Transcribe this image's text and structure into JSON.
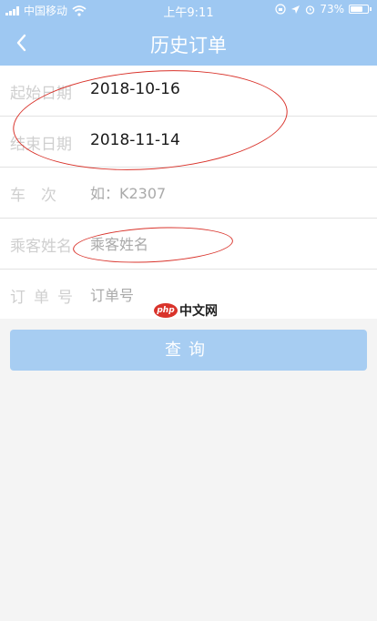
{
  "status_bar": {
    "carrier": "中国移动",
    "time": "上午9:11",
    "battery_text": "73%",
    "battery_level": 0.73,
    "icons": [
      "signal-icon",
      "wifi-icon",
      "lock-rotation-icon",
      "location-icon",
      "alarm-icon",
      "battery-icon"
    ]
  },
  "nav": {
    "title": "历史订单",
    "back_icon": "chevron-left-icon"
  },
  "form": {
    "start_date": {
      "label": "起始日期",
      "value": "2018-10-16"
    },
    "end_date": {
      "label": "结束日期",
      "value": "2018-11-14"
    },
    "train_no": {
      "label": "车　次",
      "placeholder": "如：K2307"
    },
    "passenger": {
      "label": "乘客姓名",
      "placeholder": "乘客姓名"
    },
    "order_no": {
      "label": "订单号",
      "placeholder": "订单号"
    }
  },
  "query_button": {
    "label": "查询"
  },
  "watermark": {
    "logo": "php",
    "text": "中文网"
  },
  "colors": {
    "header": "#9ec8f2",
    "button": "#a7cdf2",
    "annotation": "#d9332b",
    "background": "#f4f4f4"
  }
}
